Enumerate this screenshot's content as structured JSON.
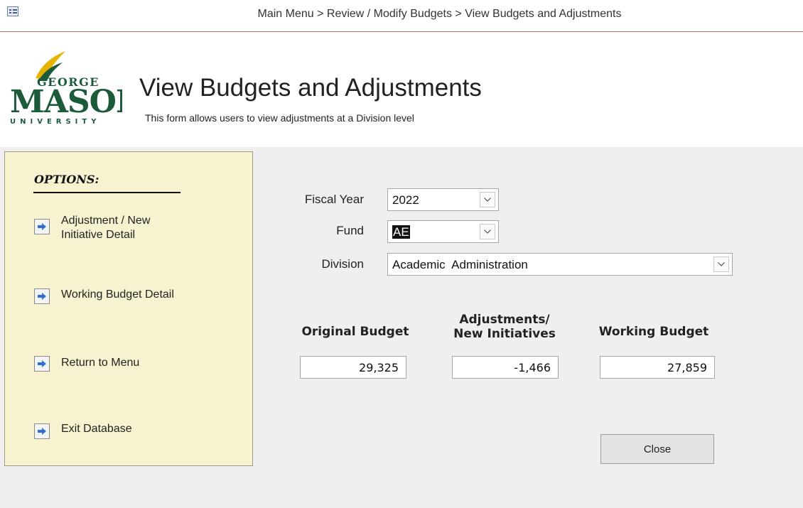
{
  "window": {
    "breadcrumb": "Main Menu > Review / Modify Budgets > View Budgets and Adjustments"
  },
  "header": {
    "logo_text_top": "GEORGE",
    "logo_text_main": "MASON",
    "logo_text_bottom": "UNIVERSITY",
    "title": "View Budgets and Adjustments",
    "subtitle": "This form allows users to view adjustments at a Division level"
  },
  "options": {
    "heading": "OPTIONS:",
    "items": [
      {
        "label_line1": "Adjustment / New",
        "label_line2": "Initiative Detail"
      },
      {
        "label_line1": "Working Budget Detail",
        "label_line2": ""
      },
      {
        "label_line1": "Return to Menu",
        "label_line2": ""
      },
      {
        "label_line1": "Exit Database",
        "label_line2": ""
      }
    ]
  },
  "filters": {
    "fiscal_year": {
      "label": "Fiscal Year",
      "value": "2022"
    },
    "fund": {
      "label": "Fund",
      "value": "AE"
    },
    "division": {
      "label": "Division",
      "value": "Academic  Administration"
    }
  },
  "budget": {
    "original": {
      "label": "Original Budget",
      "value": "29,325"
    },
    "adjustments": {
      "label_line1": "Adjustments/",
      "label_line2": "New Initiatives",
      "value": "-1,466"
    },
    "working": {
      "label": "Working Budget",
      "value": "27,859"
    }
  },
  "actions": {
    "close_label": "Close"
  },
  "colors": {
    "options_bg": "#f7f3d1",
    "logo_green": "#1c5b3a",
    "logo_gold": "#e6b400",
    "arrow_blue": "#2f6fd0"
  },
  "icons": [
    "form-icon",
    "arrow-right-icon",
    "chevron-down-icon"
  ]
}
